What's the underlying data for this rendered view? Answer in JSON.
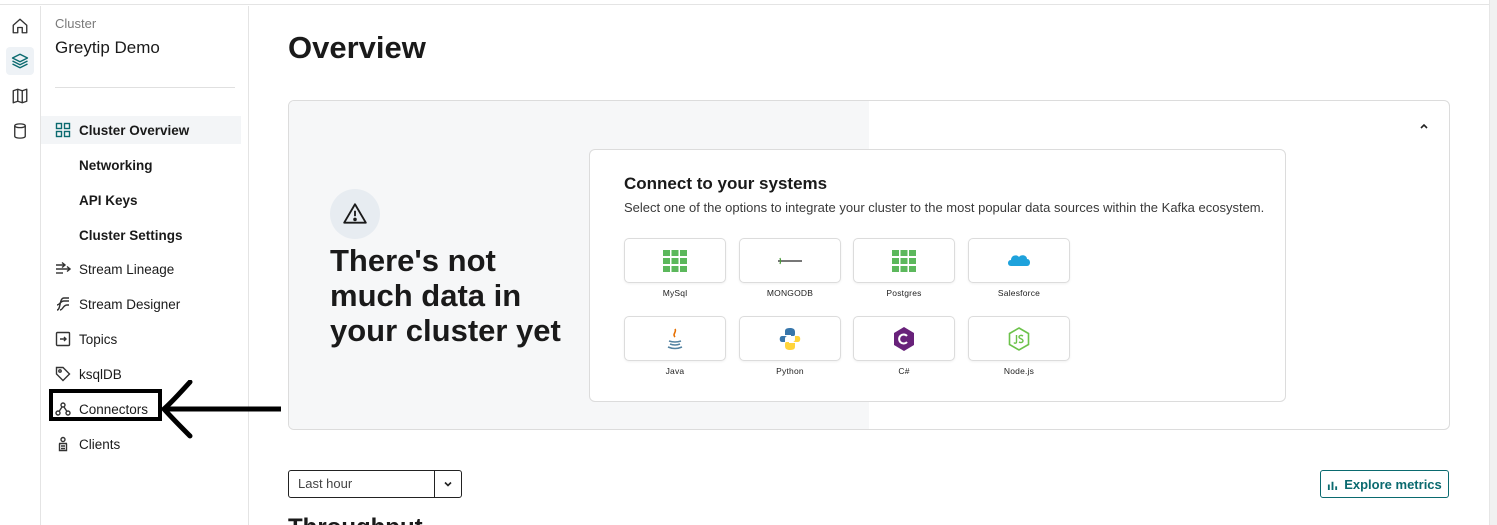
{
  "rail": {
    "items": [
      {
        "icon": "home-icon",
        "active": false
      },
      {
        "icon": "layers-icon",
        "active": true
      },
      {
        "icon": "map-icon",
        "active": false
      },
      {
        "icon": "database-icon",
        "active": false
      }
    ]
  },
  "sidebar": {
    "caption": "Cluster",
    "cluster_name": "Greytip Demo",
    "items": [
      {
        "label": "Cluster Overview",
        "icon": "grid-icon",
        "active": true
      },
      {
        "label": "Networking",
        "sub": true
      },
      {
        "label": "API Keys",
        "sub": true
      },
      {
        "label": "Cluster Settings",
        "sub": true
      },
      {
        "label": "Stream Lineage",
        "icon": "lineage-icon"
      },
      {
        "label": "Stream Designer",
        "icon": "designer-icon"
      },
      {
        "label": "Topics",
        "icon": "topics-icon"
      },
      {
        "label": "ksqlDB",
        "icon": "ksqldb-icon"
      },
      {
        "label": "Connectors",
        "icon": "connectors-icon",
        "highlighted": true
      },
      {
        "label": "Clients",
        "icon": "clients-icon"
      }
    ]
  },
  "main": {
    "title": "Overview",
    "empty_state": {
      "message": "There's not much data in your cluster yet",
      "icon": "warning-icon"
    },
    "connect": {
      "title": "Connect to your systems",
      "description": "Select one of the options to integrate your cluster to the most popular data sources within the Kafka ecosystem.",
      "tiles": [
        {
          "label": "MySql",
          "icon": "mysql-icon"
        },
        {
          "label": "MONGODB",
          "icon": "mongodb-icon"
        },
        {
          "label": "Postgres",
          "icon": "postgres-icon"
        },
        {
          "label": "Salesforce",
          "icon": "salesforce-icon"
        },
        {
          "label": "Java",
          "icon": "java-icon"
        },
        {
          "label": "Python",
          "icon": "python-icon"
        },
        {
          "label": "C#",
          "icon": "csharp-icon"
        },
        {
          "label": "Node.js",
          "icon": "nodejs-icon"
        }
      ]
    },
    "time_range": {
      "value": "Last hour"
    },
    "explore_metrics_label": "Explore metrics",
    "next_heading": "Throughput"
  },
  "colors": {
    "accent": "#0a6a6f",
    "border": "#dcdcdc",
    "annotation": "#000000"
  }
}
